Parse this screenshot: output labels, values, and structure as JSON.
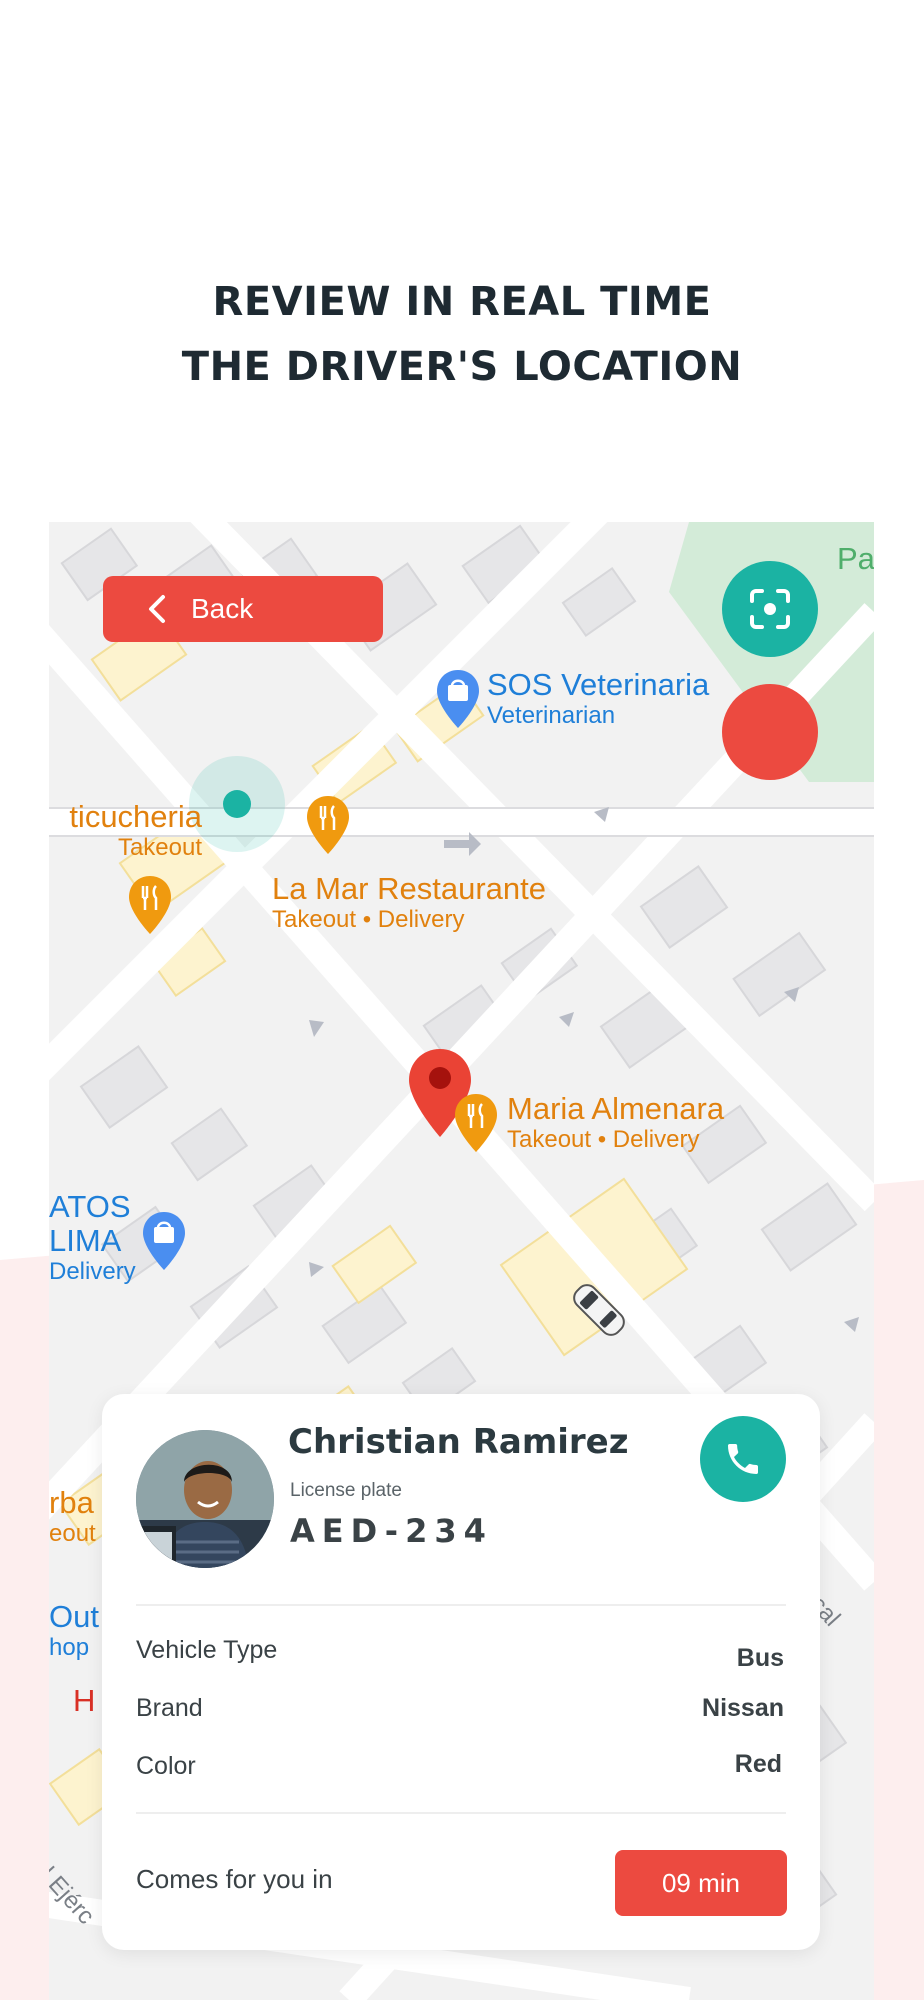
{
  "headline": {
    "line1": "REVIEW IN REAL TIME",
    "line2": "THE DRIVER'S LOCATION"
  },
  "map": {
    "back_label": "Back",
    "pois": {
      "sos": {
        "title": "SOS Veterinaria",
        "sub": "Veterinarian"
      },
      "lamar": {
        "title": "La Mar Restaurante",
        "sub": "Takeout • Delivery"
      },
      "maria": {
        "title": "Maria Almenara",
        "sub": "Takeout • Delivery"
      },
      "cevicheria": {
        "title": "ticucheria",
        "sub": "Takeout"
      },
      "atos": {
        "title1": "ATOS",
        "title2": "LIMA",
        "sub": "Delivery"
      },
      "left_partial_1": {
        "title": "rba",
        "sub": "eout"
      },
      "left_partial_2": {
        "title": "Out",
        "sub": "hop"
      },
      "left_partial_3": {
        "title": "H"
      },
      "top_right": {
        "title": "Pa"
      },
      "street1": {
        "title": "ariscal L"
      },
      "street2": {
        "title": "l Ejérc"
      }
    }
  },
  "driver_card": {
    "name": "Christian Ramirez",
    "plate_label": "License plate",
    "plate": "AED-234",
    "rows": [
      {
        "label": "Vehicle Type",
        "value": "Bus"
      },
      {
        "label": "Brand",
        "value": "Nissan"
      },
      {
        "label": "Color",
        "value": "Red"
      }
    ],
    "eta_label": "Comes for you in",
    "eta_value": "09 min"
  },
  "colors": {
    "accent_red": "#ec4a40",
    "accent_teal": "#1bb3a3",
    "bg_pink": "#fdeeee"
  },
  "icons": [
    "back-chevron-icon",
    "focus-location-icon",
    "phone-icon",
    "map-pin-icon",
    "car-icon",
    "restaurant-pin-icon",
    "shop-pin-icon"
  ]
}
